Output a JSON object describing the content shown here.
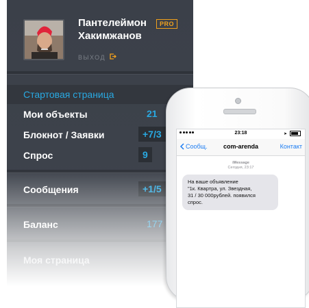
{
  "profile": {
    "name_line1": "Пантелеймон",
    "name_line2": "Хакимжанов",
    "badge": "PRO",
    "logout_label": "выход"
  },
  "menu": {
    "items": [
      {
        "label": "Стартовая страница",
        "count": "",
        "active": true
      },
      {
        "label": "Мои объекты",
        "count": "21"
      },
      {
        "label": "Блокнот / Заявки",
        "count": "+7/3"
      },
      {
        "label": "Спрос",
        "count": "9"
      },
      {
        "label": "Сообщения",
        "count": "+1/5"
      },
      {
        "label": "Баланс",
        "count": "177 р"
      },
      {
        "label": "Моя страница",
        "count": ""
      }
    ]
  },
  "phone": {
    "status": {
      "time": "23:18"
    },
    "nav": {
      "back_label": "Сообщ.",
      "title": "com-arenda",
      "contact_label": "Контакт"
    },
    "message": {
      "service": "iMessage",
      "date": "Сегодня, 23:17",
      "lines": [
        "На ваше объявление",
        "\"1к. Квартра, ул. Звездная,",
        "31 / 30 000рублей. появился",
        "спрос."
      ]
    }
  },
  "colors": {
    "menu_bg": "#3f444d",
    "accent_blue": "#29a9e2",
    "pro_orange": "#f2a11c",
    "ios_blue": "#1b7cf2"
  }
}
